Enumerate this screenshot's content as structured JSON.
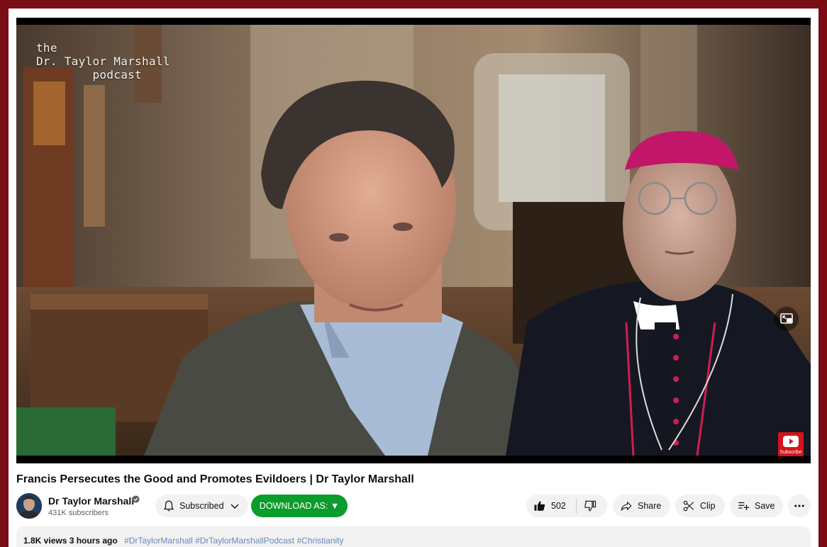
{
  "video": {
    "overlay_text": "the\nDr. Taylor Marshall\n        podcast",
    "subscribe_watermark": "Subscribe",
    "title": "Francis Persecutes the Good and Promotes Evildoers | Dr Taylor Marshall"
  },
  "channel": {
    "name": "Dr Taylor Marshall",
    "subscribers": "431K subscribers",
    "subscribed_label": "Subscribed"
  },
  "actions": {
    "download_label": "DOWNLOAD AS: ▼",
    "like_count": "502",
    "share_label": "Share",
    "clip_label": "Clip",
    "save_label": "Save"
  },
  "description": {
    "stats": "1.8K views  3 hours ago",
    "hashtags": "#DrTaylorMarshall #DrTaylorMarshallPodcast #Christianity"
  },
  "icons": {
    "verified": "verified-badge-icon",
    "bell": "bell-icon",
    "chevron": "chevron-down-icon",
    "like": "thumbs-up-icon",
    "dislike": "thumbs-down-icon",
    "share": "share-arrow-icon",
    "clip": "scissors-icon",
    "save": "playlist-add-icon",
    "more": "more-horizontal-icon",
    "pip": "picture-in-picture-icon"
  },
  "colors": {
    "page_border": "#7a0d14",
    "download_button": "#0a9d2b",
    "youtube_red": "#d4141b"
  }
}
